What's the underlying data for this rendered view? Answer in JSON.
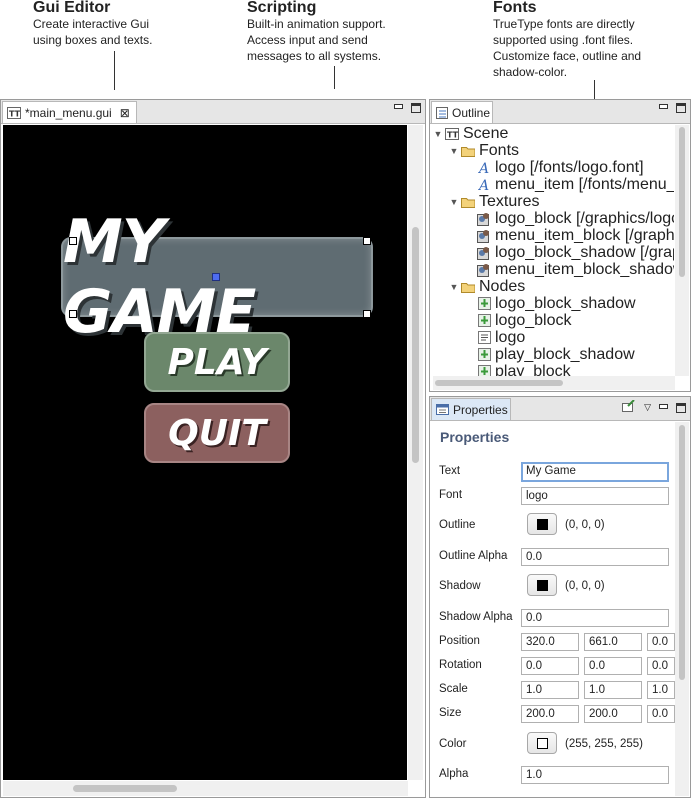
{
  "annotations": [
    {
      "title": "Gui Editor",
      "lines": [
        "Create interactive Gui",
        "using boxes and texts."
      ]
    },
    {
      "title": "Scripting",
      "lines": [
        "Built-in animation support.",
        "Access input and send",
        "messages to all systems."
      ]
    },
    {
      "title": "Fonts",
      "lines": [
        "TrueType fonts are directly",
        "supported using .font files.",
        "Customize face, outline and",
        "shadow-color."
      ]
    }
  ],
  "editor": {
    "tab_label": "*main_menu.gui",
    "tab_icon": "gui-file-icon",
    "logo_text": "MY GAME",
    "play_text": "PLAY",
    "quit_text": "QUIT",
    "colors": {
      "logo_box": "#5e6b70",
      "play_box": "#6e8a6e",
      "quit_box": "#8e6160"
    }
  },
  "outline": {
    "tab_label": "Outline",
    "items": [
      {
        "label": "Scene",
        "icon": "scene-icon",
        "twisty": "▼"
      },
      {
        "label": "Fonts",
        "icon": "folder-icon",
        "twisty": "▼"
      },
      {
        "label": "logo [/fonts/logo.font]",
        "icon": "font-icon",
        "twisty": ""
      },
      {
        "label": "menu_item [/fonts/menu_item.font]",
        "icon": "font-icon",
        "twisty": ""
      },
      {
        "label": "Textures",
        "icon": "folder-icon",
        "twisty": "▼"
      },
      {
        "label": "logo_block [/graphics/logo_block.png]",
        "icon": "texture-icon",
        "twisty": ""
      },
      {
        "label": "menu_item_block [/graphics/menu_item_block.png]",
        "icon": "texture-icon",
        "twisty": ""
      },
      {
        "label": "logo_block_shadow [/graphics/logo_block_shadow.png]",
        "icon": "texture-icon",
        "twisty": ""
      },
      {
        "label": "menu_item_block_shadow [/graphics/menu_item_block_shadow.png]",
        "icon": "texture-icon",
        "twisty": ""
      },
      {
        "label": "Nodes",
        "icon": "folder-icon",
        "twisty": "▼"
      },
      {
        "label": "logo_block_shadow",
        "icon": "box-node-icon",
        "twisty": ""
      },
      {
        "label": "logo_block",
        "icon": "box-node-icon",
        "twisty": ""
      },
      {
        "label": "logo",
        "icon": "text-node-icon",
        "twisty": ""
      },
      {
        "label": "play_block_shadow",
        "icon": "box-node-icon",
        "twisty": ""
      },
      {
        "label": "play_block",
        "icon": "box-node-icon",
        "twisty": ""
      }
    ]
  },
  "properties": {
    "tab_label": "Properties",
    "heading": "Properties",
    "text": {
      "label": "Text",
      "value": "My Game"
    },
    "font": {
      "label": "Font",
      "value": "logo"
    },
    "outline": {
      "label": "Outline",
      "value": "(0, 0, 0)",
      "swatch": "#000000"
    },
    "outline_alpha": {
      "label": "Outline Alpha",
      "value": "0.0"
    },
    "shadow": {
      "label": "Shadow",
      "value": "(0, 0, 0)",
      "swatch": "#000000"
    },
    "shadow_alpha": {
      "label": "Shadow Alpha",
      "value": "0.0"
    },
    "position": {
      "label": "Position",
      "x": "320.0",
      "y": "661.0",
      "z": "0.0"
    },
    "rotation": {
      "label": "Rotation",
      "x": "0.0",
      "y": "0.0",
      "z": "0.0"
    },
    "scale": {
      "label": "Scale",
      "x": "1.0",
      "y": "1.0",
      "z": "1.0"
    },
    "size": {
      "label": "Size",
      "x": "200.0",
      "y": "200.0",
      "z": "0.0"
    },
    "color": {
      "label": "Color",
      "value": "(255, 255, 255)",
      "swatch": "#ffffff"
    },
    "alpha": {
      "label": "Alpha",
      "value": "1.0"
    }
  }
}
